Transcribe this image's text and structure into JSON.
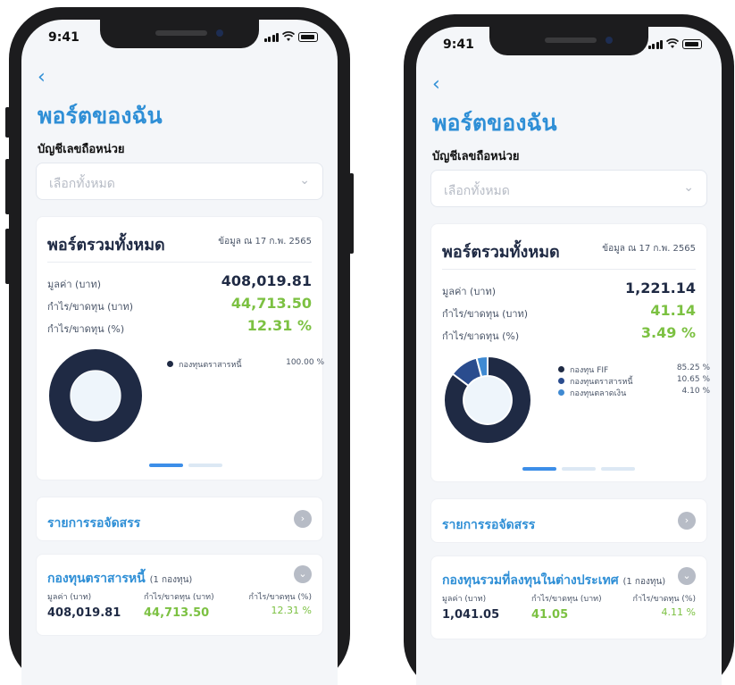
{
  "status_time": "9:41",
  "back_icon": "chevron-left-icon",
  "screens": [
    {
      "page_title": "พอร์ตของฉัน",
      "account_label": "บัญชีเลขถือหน่วย",
      "select_placeholder": "เลือกทั้งหมด",
      "summary": {
        "title": "พอร์ตรวมทั้งหมด",
        "as_of": "ข้อมูล ณ 17 ก.พ. 2565",
        "value_label": "มูลค่า (บาท)",
        "value": "408,019.81",
        "pl_label": "กำไร/ขาดทุน (บาท)",
        "pl": "44,713.50",
        "plpct_label": "กำไร/ขาดทุน (%)",
        "plpct": "12.31 %"
      },
      "legend": [
        {
          "name": "กองทุนตราสารหนี้",
          "pct": "100.00 %",
          "color": "#1f2a44"
        }
      ],
      "pending_label": "รายการรอจัดสรร",
      "fund": {
        "title": "กองทุนตราสารหนี้",
        "count": "(1 กองทุน)",
        "value_label": "มูลค่า (บาท)",
        "pl_label": "กำไร/ขาดทุน (บาท)",
        "plpct_label": "กำไร/ขาดทุน (%)",
        "value": "408,019.81",
        "pl": "44,713.50",
        "plpct": "12.31 %"
      }
    },
    {
      "page_title": "พอร์ตของฉัน",
      "account_label": "บัญชีเลขถือหน่วย",
      "select_placeholder": "เลือกทั้งหมด",
      "summary": {
        "title": "พอร์ตรวมทั้งหมด",
        "as_of": "ข้อมูล ณ 17 ก.พ. 2565",
        "value_label": "มูลค่า (บาท)",
        "value": "1,221.14",
        "pl_label": "กำไร/ขาดทุน (บาท)",
        "pl": "41.14",
        "plpct_label": "กำไร/ขาดทุน (%)",
        "plpct": "3.49 %"
      },
      "legend": [
        {
          "name": "กองทุน FIF",
          "pct": "85.25 %",
          "color": "#1f2a44"
        },
        {
          "name": "กองทุนตราสารหนี้",
          "pct": "10.65 %",
          "color": "#2a4c8e"
        },
        {
          "name": "กองทุนตลาดเงิน",
          "pct": "4.10 %",
          "color": "#3f8ad2"
        }
      ],
      "pending_label": "รายการรอจัดสรร",
      "fund": {
        "title": "กองทุนรวมที่ลงทุนในต่างประเทศ",
        "count": "(1 กองทุน)",
        "value_label": "มูลค่า (บาท)",
        "pl_label": "กำไร/ขาดทุน (บาท)",
        "plpct_label": "กำไร/ขาดทุน (%)",
        "value": "1,041.05",
        "pl": "41.05",
        "plpct": "4.11 %"
      }
    }
  ],
  "chart_data": [
    {
      "type": "pie",
      "categories": [
        "กองทุนตราสารหนี้"
      ],
      "values": [
        100.0
      ]
    },
    {
      "type": "pie",
      "categories": [
        "กองทุน FIF",
        "กองทุนตราสารหนี้",
        "กองทุนตลาดเงิน"
      ],
      "values": [
        85.25,
        10.65,
        4.1
      ]
    }
  ],
  "colors": {
    "accent": "#2f8fd6",
    "positive": "#7cc142",
    "navy": "#1f2a44"
  }
}
